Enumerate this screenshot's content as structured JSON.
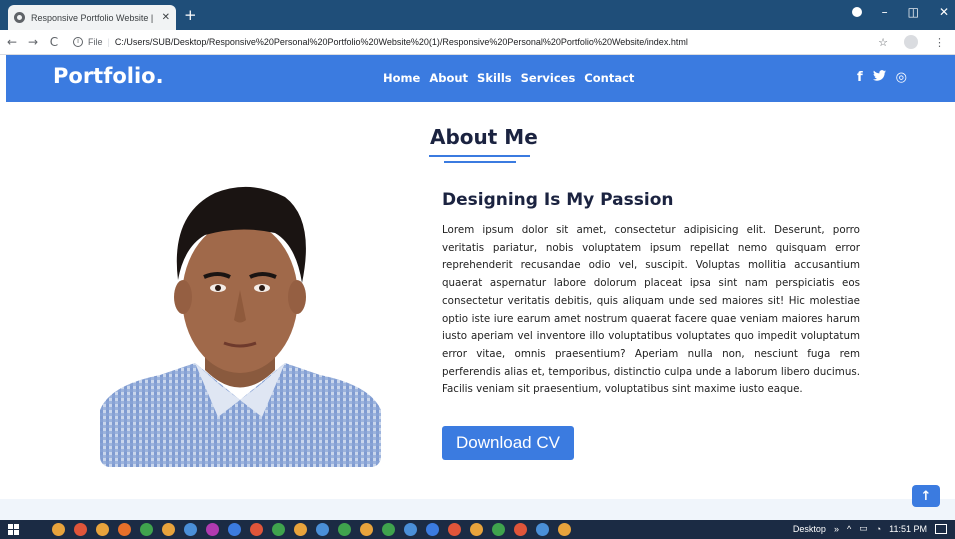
{
  "browser": {
    "tab_title": "Responsive Portfolio Website | C",
    "tab_close": "✕",
    "new_tab": "+",
    "url_file_label": "File",
    "url": "C:/Users/SUB/Desktop/Responsive%20Personal%20Portfolio%20Website%20(1)/Responsive%20Personal%20Portfolio%20Website/index.html",
    "back": "←",
    "forward": "→",
    "reload": "C",
    "minimize": "–",
    "maximize": "◫",
    "close": "✕",
    "star": "☆",
    "menu": "⋮"
  },
  "site": {
    "logo": "Portfolio.",
    "menu": [
      "Home",
      "About",
      "Skills",
      "Services",
      "Contact"
    ],
    "social": [
      "f",
      "🐦",
      "◎"
    ]
  },
  "about": {
    "title": "About Me",
    "subtitle": "Designing Is My Passion",
    "paragraph": "Lorem ipsum dolor sit amet, consectetur adipisicing elit. Deserunt, porro veritatis pariatur, nobis voluptatem ipsum repellat nemo quisquam error reprehenderit recusandae odio vel, suscipit. Voluptas mollitia accusantium quaerat aspernatur labore dolorum placeat ipsa sint nam perspiciatis eos consectetur veritatis debitis, quis aliquam unde sed maiores sit! Hic molestiae optio iste iure earum amet nostrum quaerat facere quae veniam maiores harum iusto aperiam vel inventore illo voluptatibus voluptates quo impedit voluptatum error vitae, omnis praesentium? Aperiam nulla non, nesciunt fuga rem perferendis alias et, temporibus, distinctio culpa unde a laborum libero ducimus. Facilis veniam sit praesentium, voluptatibus sint maxime iusto eaque.",
    "cv_button": "Download CV"
  },
  "scroll_top": "↑",
  "taskbar": {
    "desktop_label": "Desktop",
    "chevrons": "»",
    "up_arrow": "^",
    "time": "11:51 PM",
    "app_colors": [
      "#e8a33c",
      "#e0553a",
      "#e8a33c",
      "#e8702a",
      "#3fa34d",
      "#e8a33c",
      "#4a8fd8",
      "#b03ab0",
      "#3b7be0",
      "#e0553a",
      "#3fa34d",
      "#e8a33c",
      "#4a8fd8",
      "#3fa34d",
      "#e8a33c",
      "#3fa34d",
      "#4a8fd8",
      "#3b7be0",
      "#e0553a",
      "#e8a33c",
      "#3fa34d",
      "#e0553a",
      "#4a8fd8",
      "#e8a33c"
    ]
  },
  "colors": {
    "brand_blue": "#3b7be0",
    "tab_bar": "#1f4e79",
    "heading": "#1b2340"
  }
}
